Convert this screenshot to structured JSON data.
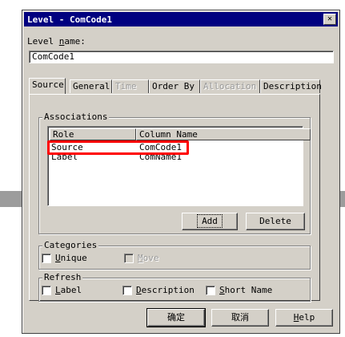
{
  "window": {
    "title": "Level - ComCode1",
    "close_glyph": "✕"
  },
  "level_name": {
    "label_prefix": "Level ",
    "label_accel": "n",
    "label_suffix": "ame:",
    "value": "ComCode1"
  },
  "tabs": [
    {
      "label": "Source",
      "state": "active"
    },
    {
      "label": "General",
      "state": "normal"
    },
    {
      "label": "Time",
      "state": "disabled"
    },
    {
      "label": "Order By",
      "state": "normal"
    },
    {
      "label": "Allocation",
      "state": "disabled"
    },
    {
      "label": "Description",
      "state": "normal"
    }
  ],
  "associations": {
    "title": "Associations",
    "columns": [
      "Role",
      "Column Name"
    ],
    "rows": [
      {
        "role": "Source",
        "column": "ComCode1"
      },
      {
        "role": "Label",
        "column": "ComName1"
      }
    ],
    "add_label": "Add",
    "delete_label": "Delete"
  },
  "categories": {
    "title": "Categories",
    "unique": {
      "accel": "U",
      "rest": "nique",
      "checked": false
    },
    "move": {
      "accel": "M",
      "rest": "ove",
      "checked": false,
      "disabled": true
    }
  },
  "refresh": {
    "title": "Refresh",
    "label": {
      "accel": "L",
      "rest": "abel",
      "checked": false
    },
    "description": {
      "accel": "D",
      "rest": "escription",
      "checked": false
    },
    "short_name": {
      "accel": "S",
      "rest": "hort Name",
      "checked": false
    }
  },
  "footer": {
    "ok_label": "确定",
    "cancel_label": "取消",
    "help_accel": "H",
    "help_rest": "elp"
  },
  "colors": {
    "titlebar": "#000080",
    "face": "#d4d0c8",
    "highlight_box": "#ff0000"
  }
}
